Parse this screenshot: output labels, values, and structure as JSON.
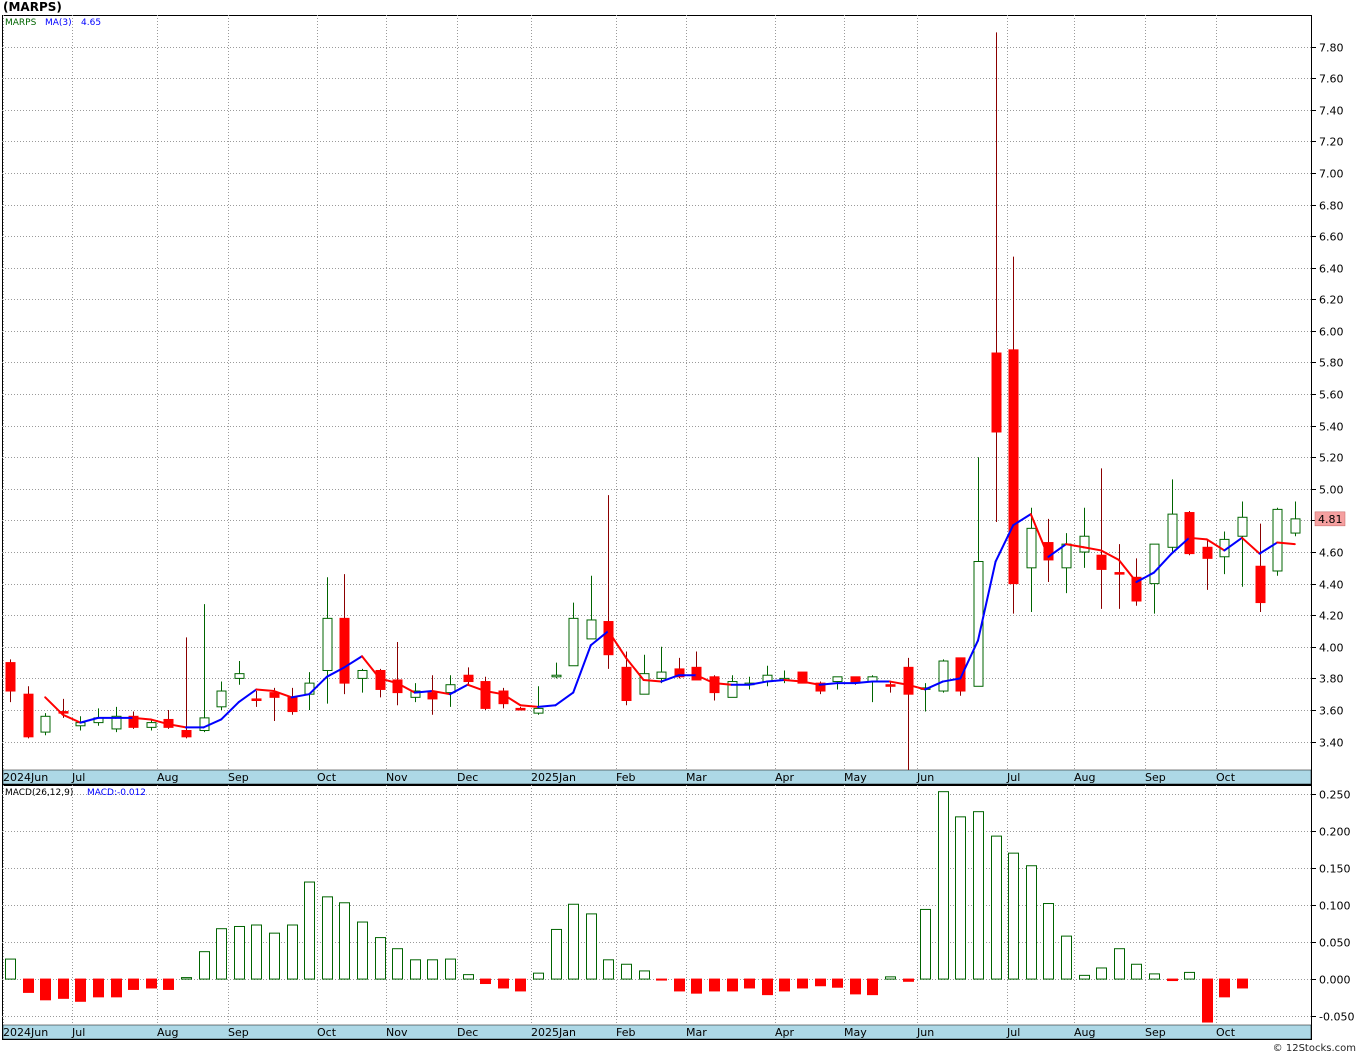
{
  "header": {
    "title": "(MARPS)"
  },
  "footer": {
    "watermark": "© 12Stocks.com"
  },
  "colors": {
    "up": "#006400",
    "down": "#ff0000",
    "ma_up": "#0000ff",
    "ma_down": "#ff0000",
    "grid": "#9a9a9a",
    "axis_strip": "#add8e6"
  },
  "chart_data": [
    {
      "type": "candlestick",
      "legend": {
        "symbol": "MARPS",
        "ma_label": "MA(3)",
        "ma_value": "4.65"
      },
      "last_price_label": "4.81",
      "ylim": [
        3.22,
        8.0
      ],
      "y_ticks": [
        "3.40",
        "3.60",
        "3.80",
        "4.00",
        "4.20",
        "4.40",
        "4.60",
        "4.80",
        "5.00",
        "5.20",
        "5.40",
        "5.60",
        "5.80",
        "6.00",
        "6.20",
        "6.40",
        "6.60",
        "6.80",
        "7.00",
        "7.20",
        "7.40",
        "7.60",
        "7.80"
      ],
      "x_labels": [
        "2024Jun",
        "Jul",
        "Aug",
        "Sep",
        "Oct",
        "Nov",
        "Dec",
        "2025Jan",
        "Feb",
        "Mar",
        "Apr",
        "May",
        "Jun",
        "Jul",
        "Aug",
        "Sep",
        "Oct"
      ],
      "candles": [
        [
          3.9,
          3.92,
          3.65,
          3.72
        ],
        [
          3.7,
          3.75,
          3.42,
          3.43
        ],
        [
          3.46,
          3.58,
          3.44,
          3.56
        ],
        [
          3.59,
          3.67,
          3.55,
          3.58
        ],
        [
          3.5,
          3.56,
          3.47,
          3.52
        ],
        [
          3.52,
          3.61,
          3.5,
          3.55
        ],
        [
          3.48,
          3.62,
          3.46,
          3.56
        ],
        [
          3.56,
          3.59,
          3.48,
          3.49
        ],
        [
          3.49,
          3.54,
          3.47,
          3.52
        ],
        [
          3.54,
          3.6,
          3.48,
          3.49
        ],
        [
          3.47,
          4.06,
          3.42,
          3.43
        ],
        [
          3.47,
          4.27,
          3.46,
          3.55
        ],
        [
          3.62,
          3.78,
          3.6,
          3.72
        ],
        [
          3.8,
          3.91,
          3.76,
          3.83
        ],
        [
          3.67,
          3.72,
          3.62,
          3.66
        ],
        [
          3.71,
          3.74,
          3.53,
          3.68
        ],
        [
          3.68,
          3.74,
          3.57,
          3.59
        ],
        [
          3.7,
          3.84,
          3.6,
          3.77
        ],
        [
          3.85,
          4.44,
          3.64,
          4.18
        ],
        [
          4.18,
          4.46,
          3.7,
          3.77
        ],
        [
          3.8,
          3.86,
          3.71,
          3.85
        ],
        [
          3.85,
          3.86,
          3.68,
          3.73
        ],
        [
          3.79,
          4.03,
          3.63,
          3.71
        ],
        [
          3.68,
          3.77,
          3.65,
          3.72
        ],
        [
          3.71,
          3.82,
          3.57,
          3.67
        ],
        [
          3.71,
          3.82,
          3.62,
          3.76
        ],
        [
          3.82,
          3.87,
          3.76,
          3.78
        ],
        [
          3.78,
          3.81,
          3.6,
          3.61
        ],
        [
          3.72,
          3.74,
          3.61,
          3.64
        ],
        [
          3.61,
          3.62,
          3.6,
          3.6
        ],
        [
          3.58,
          3.75,
          3.57,
          3.61
        ],
        [
          3.81,
          3.9,
          3.8,
          3.82
        ],
        [
          3.88,
          4.28,
          3.88,
          4.18
        ],
        [
          4.05,
          4.45,
          4.08,
          4.17
        ],
        [
          4.16,
          4.96,
          3.86,
          3.95
        ],
        [
          3.87,
          3.97,
          3.63,
          3.66
        ],
        [
          3.7,
          3.95,
          3.7,
          3.83
        ],
        [
          3.8,
          4.0,
          3.77,
          3.84
        ],
        [
          3.86,
          3.93,
          3.8,
          3.81
        ],
        [
          3.87,
          3.97,
          3.8,
          3.79
        ],
        [
          3.81,
          3.82,
          3.66,
          3.71
        ],
        [
          3.68,
          3.82,
          3.68,
          3.78
        ],
        [
          3.76,
          3.81,
          3.73,
          3.77
        ],
        [
          3.78,
          3.88,
          3.75,
          3.82
        ],
        [
          3.79,
          3.85,
          3.77,
          3.8
        ],
        [
          3.84,
          3.84,
          3.78,
          3.77
        ],
        [
          3.77,
          3.78,
          3.7,
          3.72
        ],
        [
          3.78,
          3.81,
          3.73,
          3.81
        ],
        [
          3.81,
          3.81,
          3.76,
          3.77
        ],
        [
          3.78,
          3.82,
          3.65,
          3.81
        ],
        [
          3.76,
          3.78,
          3.71,
          3.75
        ],
        [
          3.87,
          3.93,
          3.22,
          3.7
        ],
        [
          3.74,
          3.77,
          3.59,
          3.74
        ],
        [
          3.72,
          3.92,
          3.71,
          3.91
        ],
        [
          3.93,
          3.93,
          3.69,
          3.72
        ],
        [
          3.75,
          5.2,
          3.75,
          4.54
        ],
        [
          5.86,
          7.89,
          4.79,
          5.36
        ],
        [
          5.88,
          6.47,
          4.21,
          4.4
        ],
        [
          4.5,
          4.88,
          4.22,
          4.75
        ],
        [
          4.66,
          4.81,
          4.41,
          4.55
        ],
        [
          4.5,
          4.72,
          4.34,
          4.65
        ],
        [
          4.6,
          4.88,
          4.5,
          4.7
        ],
        [
          4.58,
          5.13,
          4.24,
          4.49
        ],
        [
          4.47,
          4.65,
          4.24,
          4.46
        ],
        [
          4.44,
          4.56,
          4.26,
          4.29
        ],
        [
          4.4,
          4.62,
          4.21,
          4.65
        ],
        [
          4.63,
          5.06,
          4.6,
          4.84
        ],
        [
          4.85,
          4.86,
          4.58,
          4.59
        ],
        [
          4.63,
          4.68,
          4.36,
          4.56
        ],
        [
          4.57,
          4.73,
          4.46,
          4.68
        ],
        [
          4.7,
          4.92,
          4.38,
          4.82
        ],
        [
          4.51,
          4.78,
          4.22,
          4.28
        ],
        [
          4.48,
          4.88,
          4.45,
          4.87
        ],
        [
          4.72,
          4.92,
          4.7,
          4.81
        ]
      ],
      "ma": [
        null,
        null,
        3.68,
        3.57,
        3.52,
        3.55,
        3.55,
        3.55,
        3.54,
        3.51,
        3.49,
        3.49,
        3.54,
        3.65,
        3.73,
        3.72,
        3.68,
        3.7,
        3.81,
        3.87,
        3.94,
        3.8,
        3.77,
        3.71,
        3.72,
        3.7,
        3.76,
        3.72,
        3.7,
        3.63,
        3.62,
        3.63,
        3.71,
        4.01,
        4.1,
        3.93,
        3.79,
        3.78,
        3.82,
        3.82,
        3.77,
        3.76,
        3.76,
        3.78,
        3.79,
        3.78,
        3.76,
        3.77,
        3.77,
        3.78,
        3.78,
        3.76,
        3.73,
        3.78,
        3.8,
        4.04,
        4.54,
        4.77,
        4.84,
        4.57,
        4.65,
        4.63,
        4.61,
        4.55,
        4.41,
        4.47,
        4.59,
        4.69,
        4.68,
        4.61,
        4.69,
        4.59,
        4.66,
        4.65
      ]
    },
    {
      "type": "bar",
      "legend": {
        "label": "MACD(26,12,9)",
        "value_label": "MACD:-0.012"
      },
      "ylim": [
        -0.062,
        0.262
      ],
      "y_ticks": [
        "-0.050",
        "0.000",
        "0.050",
        "0.100",
        "0.150",
        "0.200",
        "0.250"
      ],
      "x_labels": [
        "2024Jun",
        "Jul",
        "Aug",
        "Sep",
        "Oct",
        "Nov",
        "Dec",
        "2025Jan",
        "Feb",
        "Mar",
        "Apr",
        "May",
        "Jun",
        "Jul",
        "Aug",
        "Sep",
        "Oct"
      ],
      "values": [
        0.027,
        -0.018,
        -0.028,
        -0.026,
        -0.03,
        -0.024,
        -0.024,
        -0.014,
        -0.012,
        -0.014,
        0.002,
        0.037,
        0.068,
        0.071,
        0.073,
        0.062,
        0.073,
        0.131,
        0.111,
        0.103,
        0.077,
        0.056,
        0.041,
        0.026,
        0.026,
        0.027,
        0.006,
        -0.006,
        -0.012,
        -0.016,
        0.008,
        0.067,
        0.101,
        0.088,
        0.026,
        0.02,
        0.011,
        -0.001,
        -0.016,
        -0.019,
        -0.016,
        -0.016,
        -0.012,
        -0.021,
        -0.016,
        -0.012,
        -0.009,
        -0.011,
        -0.02,
        -0.021,
        0.003,
        -0.003,
        0.094,
        0.253,
        0.219,
        0.226,
        0.193,
        0.17,
        0.153,
        0.102,
        0.058,
        0.005,
        0.015,
        0.041,
        0.02,
        0.007,
        -0.002,
        0.009,
        -0.058,
        -0.024,
        -0.012
      ]
    }
  ]
}
